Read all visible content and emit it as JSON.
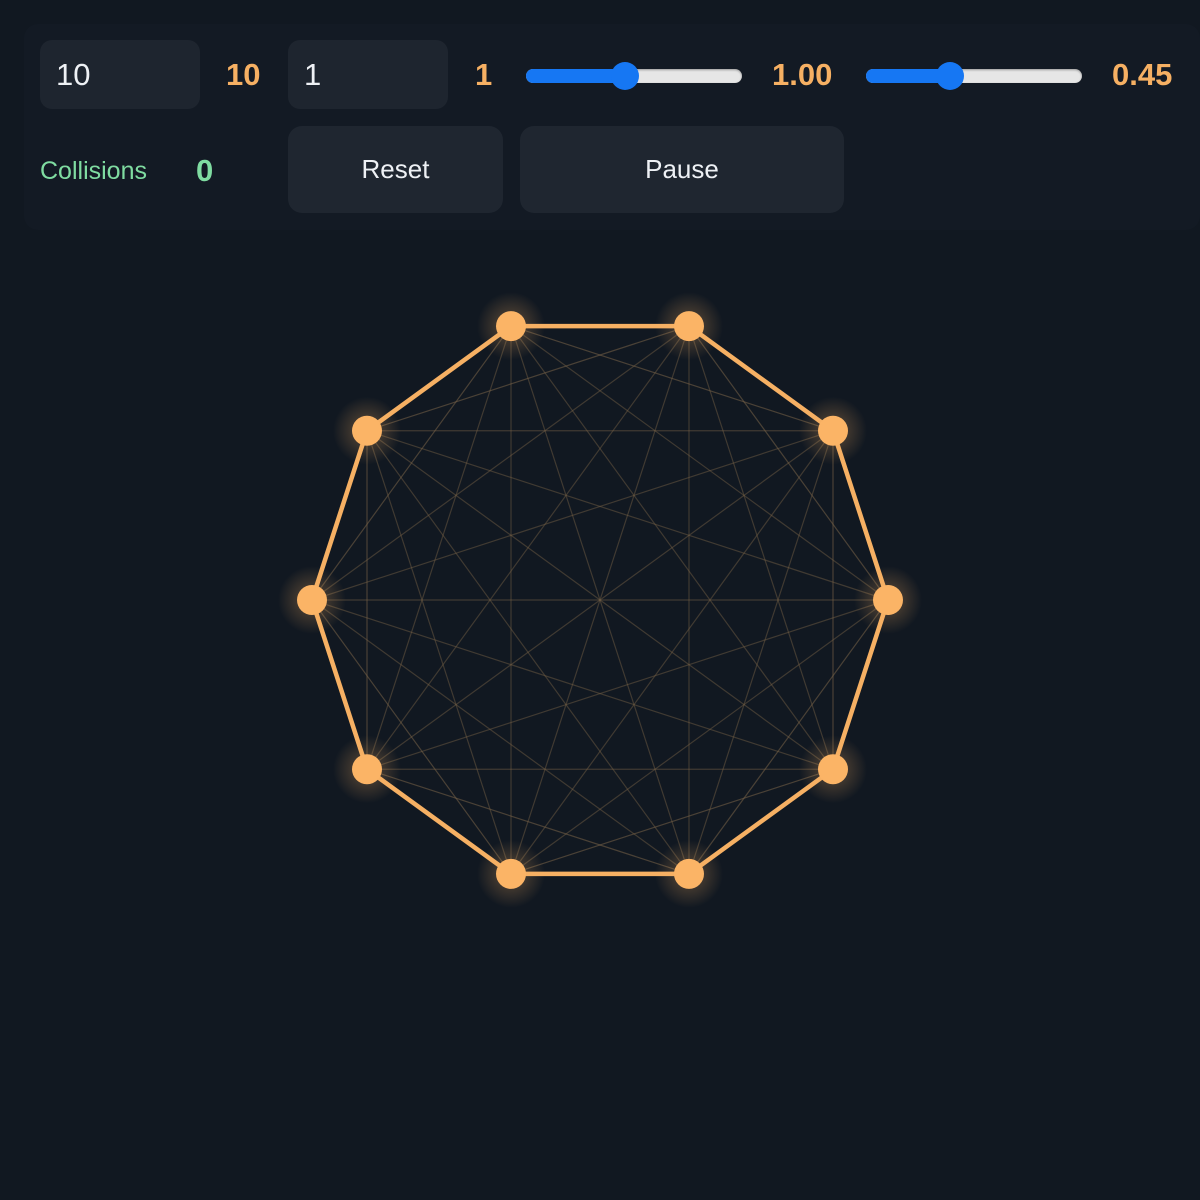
{
  "controls": {
    "count_input": "10",
    "count_value": "10",
    "step_input": "1",
    "step_value": "1",
    "speed_slider": {
      "fraction": 0.46,
      "value_label": "1.00"
    },
    "link_slider": {
      "fraction": 0.39,
      "value_label": "0.45"
    }
  },
  "stats": {
    "collisions_label": "Collisions",
    "collisions_count": "0"
  },
  "buttons": {
    "reset": "Reset",
    "pause": "Pause"
  },
  "graph": {
    "node_count": 10,
    "skip": 1,
    "colors": {
      "node": "#fbb466",
      "edge": "#f6b063",
      "chord": "#7a6448",
      "glow": "#f6b063"
    }
  }
}
